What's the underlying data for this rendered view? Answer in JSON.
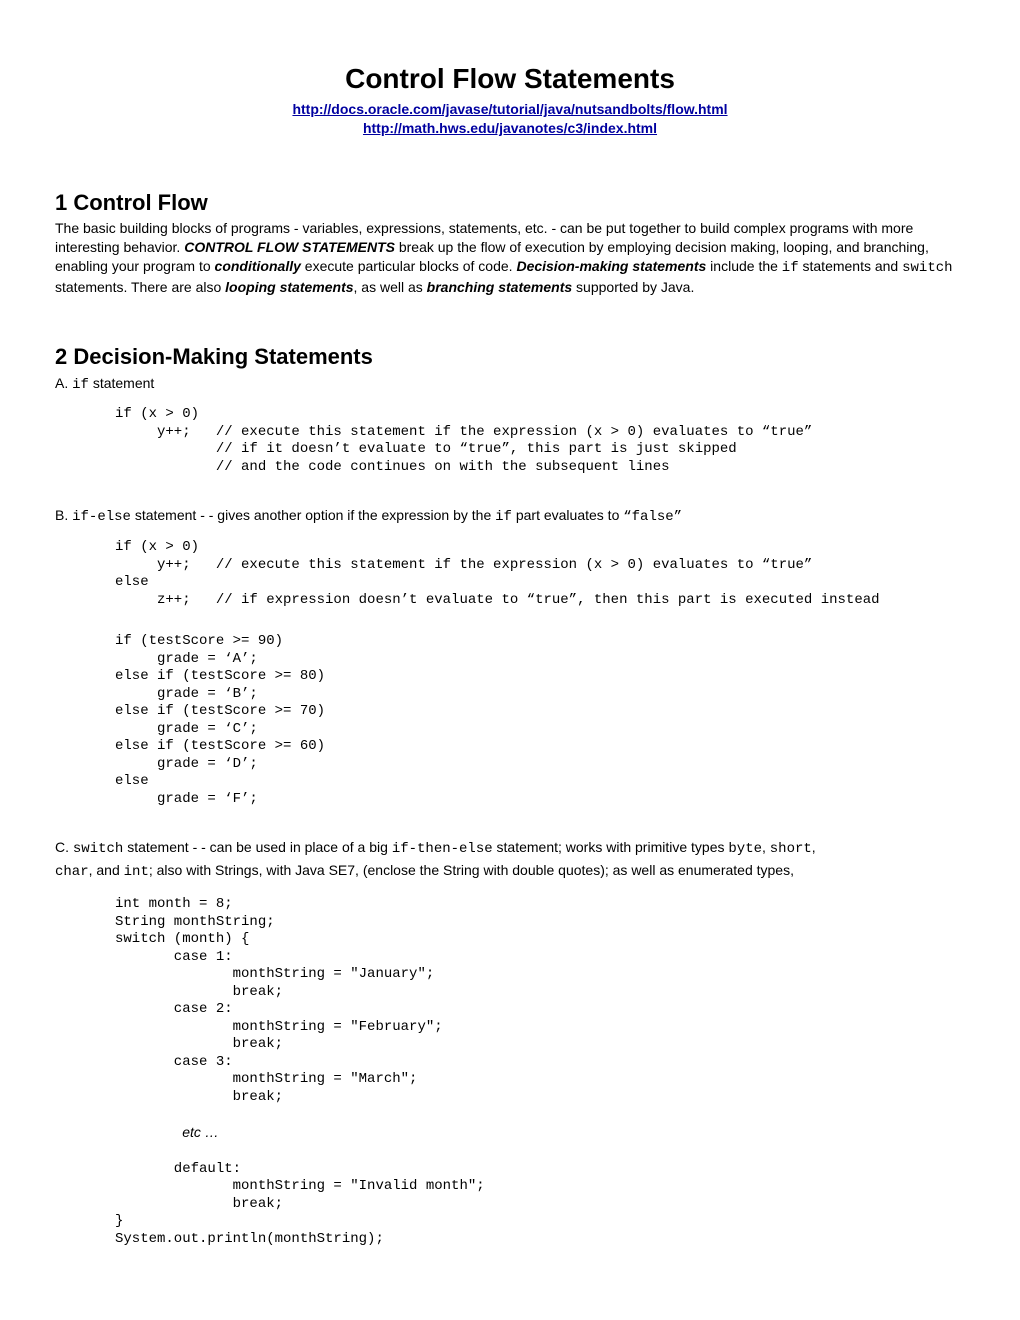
{
  "title": "Control Flow Statements",
  "link1": "http://docs.oracle.com/javase/tutorial/java/nutsandbolts/flow.html",
  "link2": "http://math.hws.edu/javanotes/c3/index.html",
  "s1": {
    "heading": "1 Control Flow",
    "p1a": "The basic building blocks of programs - variables, expressions, statements, etc. - can be put together to build complex programs with more interesting behavior.  ",
    "cfs": "CONTROL FLOW STATEMENTS",
    "p1b": " break up the flow of execution by employing decision making, looping, and branching, enabling your program to ",
    "cond": "conditionally",
    "p1c": " execute particular blocks of code.  ",
    "dms": "Decision-making statements",
    "p1d": " include the ",
    "if_code": "if",
    "p1e": " statements and ",
    "switch_code": "switch",
    "p1f": " statements.  There are also ",
    "loop": "looping statements",
    "p1g": ", as well as ",
    "branch": "branching statements",
    "p1h": " supported by Java."
  },
  "s2": {
    "heading": "2 Decision-Making Statements",
    "a": {
      "label_pre": "A. ",
      "code": "if",
      "label_post": " statement",
      "listing": "if (x > 0)\n     y++;   // execute this statement if the expression (x > 0) evaluates to “true”\n            // if it doesn’t evaluate to “true”, this part is just skipped\n            // and the code continues on with the subsequent lines"
    },
    "b": {
      "label_pre": "B. ",
      "code1": "if-else",
      "mid": " statement  - - gives another option if the expression by the ",
      "code2": "if",
      "post": " part evaluates to ",
      "false_q": "“false”",
      "listing1": "if (x > 0)\n     y++;   // execute this statement if the expression (x > 0) evaluates to “true”\nelse\n     z++;   // if expression doesn’t evaluate to “true”, then this part is executed instead",
      "listing2": "if (testScore >= 90)\n     grade = ‘A’;\nelse if (testScore >= 80)\n     grade = ‘B’;\nelse if (testScore >= 70)\n     grade = ‘C’;\nelse if (testScore >= 60)\n     grade = ‘D’;\nelse\n     grade = ‘F’;"
    },
    "c": {
      "label_pre": "C.  ",
      "code1": "switch",
      "p1": " statement  - -  can be used in place of a big ",
      "code2": "if-then-else",
      "p2": " statement; works with primitive types ",
      "code3": "byte",
      "comma1": ", ",
      "code4": "short",
      "comma2": ",",
      "line2a": "char",
      "line2b": ", and ",
      "line2c": "int",
      "line2d": "; also with Strings, with Java SE7,  (enclose the String with double quotes); as well as enumerated types,",
      "listing_a": "int month = 8;\nString monthString;\nswitch (month) {\n       case 1:\n              monthString = \"January\";\n              break;\n       case 2:\n              monthString = \"February\";\n              break;\n       case 3:\n              monthString = \"March\";\n              break;\n",
      "etc": "etc …",
      "listing_b": "\n       default:\n              monthString = \"Invalid month\";\n              break;\n}\nSystem.out.println(monthString);"
    }
  }
}
